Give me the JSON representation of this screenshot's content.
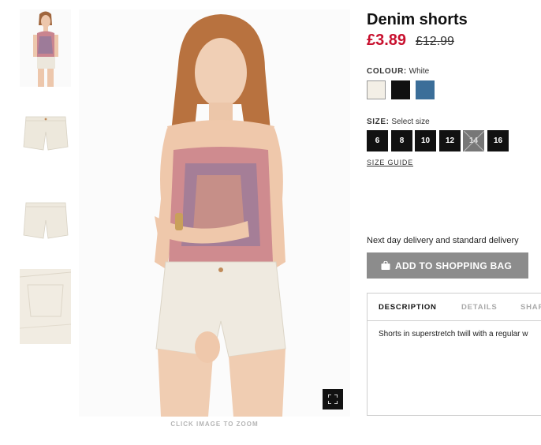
{
  "product": {
    "title": "Denim shorts",
    "price_sale": "£3.89",
    "price_original": "£12.99"
  },
  "gallery": {
    "zoom_caption": "CLICK IMAGE TO ZOOM"
  },
  "colour": {
    "label": "COLOUR:",
    "selected": "White",
    "swatches": [
      {
        "name": "White",
        "color": "#f3efe6"
      },
      {
        "name": "Black",
        "color": "#111111"
      },
      {
        "name": "Blue",
        "color": "#3b6e99"
      }
    ]
  },
  "size": {
    "label": "SIZE:",
    "prompt": "Select size",
    "options": [
      "6",
      "8",
      "10",
      "12",
      "14",
      "16"
    ],
    "guide_label": "SIZE GUIDE"
  },
  "delivery_text": "Next day delivery and standard delivery",
  "add_to_bag_label": "ADD TO SHOPPING BAG",
  "tabs": {
    "items": [
      "DESCRIPTION",
      "DETAILS",
      "SHAR"
    ],
    "description": "Shorts in superstretch twill with a regular w"
  },
  "colors": {
    "price_red": "#c8102e",
    "button_grey": "#8c8c8c"
  }
}
